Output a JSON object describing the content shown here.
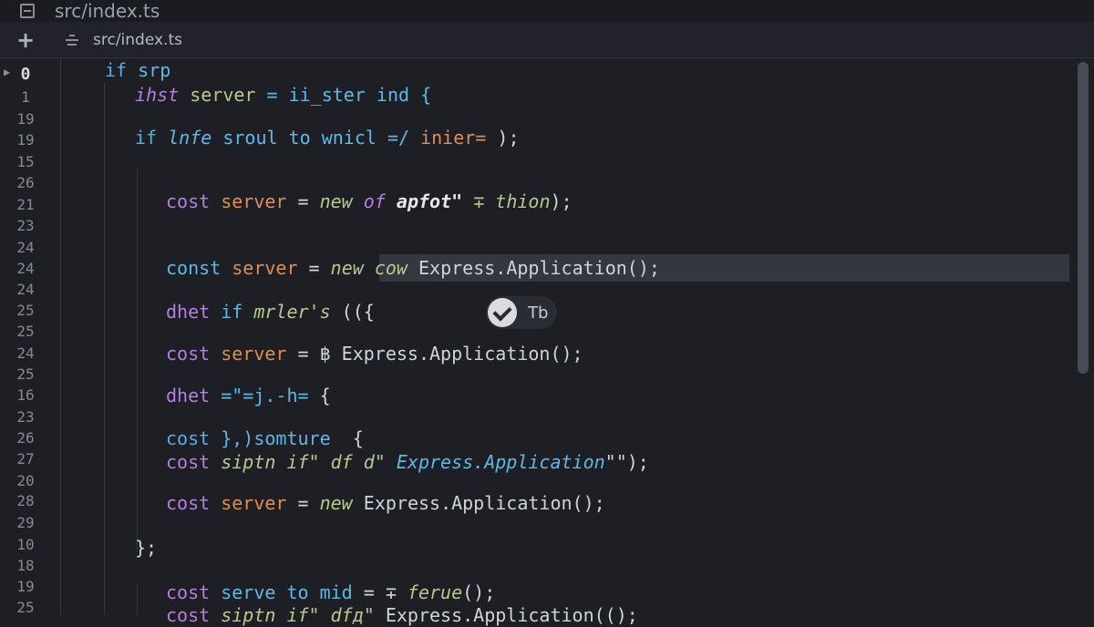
{
  "window": {
    "title": "src/index.ts"
  },
  "tab": {
    "label": "src/index.ts"
  },
  "gutter": {
    "line_numbers": [
      "0",
      "1",
      "19",
      "19",
      "15",
      "26",
      "21",
      "23",
      "24",
      "24",
      "24",
      "25",
      "25",
      "24",
      "25",
      "16",
      "23",
      "26",
      "27",
      "20",
      "28",
      "29",
      "10",
      "18",
      "19",
      "25"
    ],
    "active_index": 0
  },
  "code": {
    "l1": {
      "a": "if",
      "b": " srp"
    },
    "l2": {
      "a": "ihst",
      "b": " server",
      "c": " = ii_ster ind {"
    },
    "l3": {
      "a": "if",
      "b": " lnfe",
      "c": " sroul",
      "d": " to",
      "e": " wnicl",
      "f": " =/",
      "g": " inier=",
      "h": " );"
    },
    "l4": {
      "a": "cost",
      "b": " server",
      "c": " =",
      "d": " new",
      "e": " of",
      "f": " apfot\"",
      "g": " ∓",
      "h": " thion",
      "i": ");"
    },
    "l5": {
      "a": "const",
      "b": " server",
      "c": " =",
      "d": " new",
      "e": " cow",
      "f": " Express.Application();"
    },
    "l6": {
      "a": "dhet",
      "b": " if",
      "c": " mrler's",
      "d": " (({"
    },
    "l7": {
      "a": "cost",
      "b": " server",
      "c": " = ",
      "d": "฿",
      "e": " Express.Application();"
    },
    "l8": {
      "a": "dhet",
      "b": " =\"=j.-h=",
      "c": " {"
    },
    "l9": {
      "a": "cost",
      "b": " },)somture",
      "c": "  {"
    },
    "l10": {
      "a": "cost",
      "b": " siptn",
      "c": " if\"",
      "d": " df",
      "e": " d\"",
      "f": " Express.Application",
      "g": "\"\");"
    },
    "l11": {
      "a": "cost",
      "b": " server",
      "c": " =",
      "d": " new",
      "e": " Express.Application();"
    },
    "l12": {
      "a": "};"
    },
    "l13": {
      "a": "cost",
      "b": " serve",
      "c": " to",
      "d": " mid",
      "e": " = ∓",
      "f": " ferue",
      "g": "();"
    },
    "l14": {
      "a": "cost",
      "b": " siptn",
      "c": " if\"",
      "d": " dfд\"",
      "e": " Express.Application(();"
    }
  },
  "suggestion": {
    "label": "Tb"
  },
  "colors": {
    "background": "#1e1f25",
    "keyword": "#b57ee0",
    "keyword_blue": "#4fb0e8",
    "variable": "#e08d4f",
    "highlight": "#35373f"
  },
  "icons": {
    "title": "editor-file-icon",
    "add": "plus-icon",
    "tab": "source-file-icon",
    "fold": "chevron-right-icon",
    "accept": "check-icon"
  }
}
